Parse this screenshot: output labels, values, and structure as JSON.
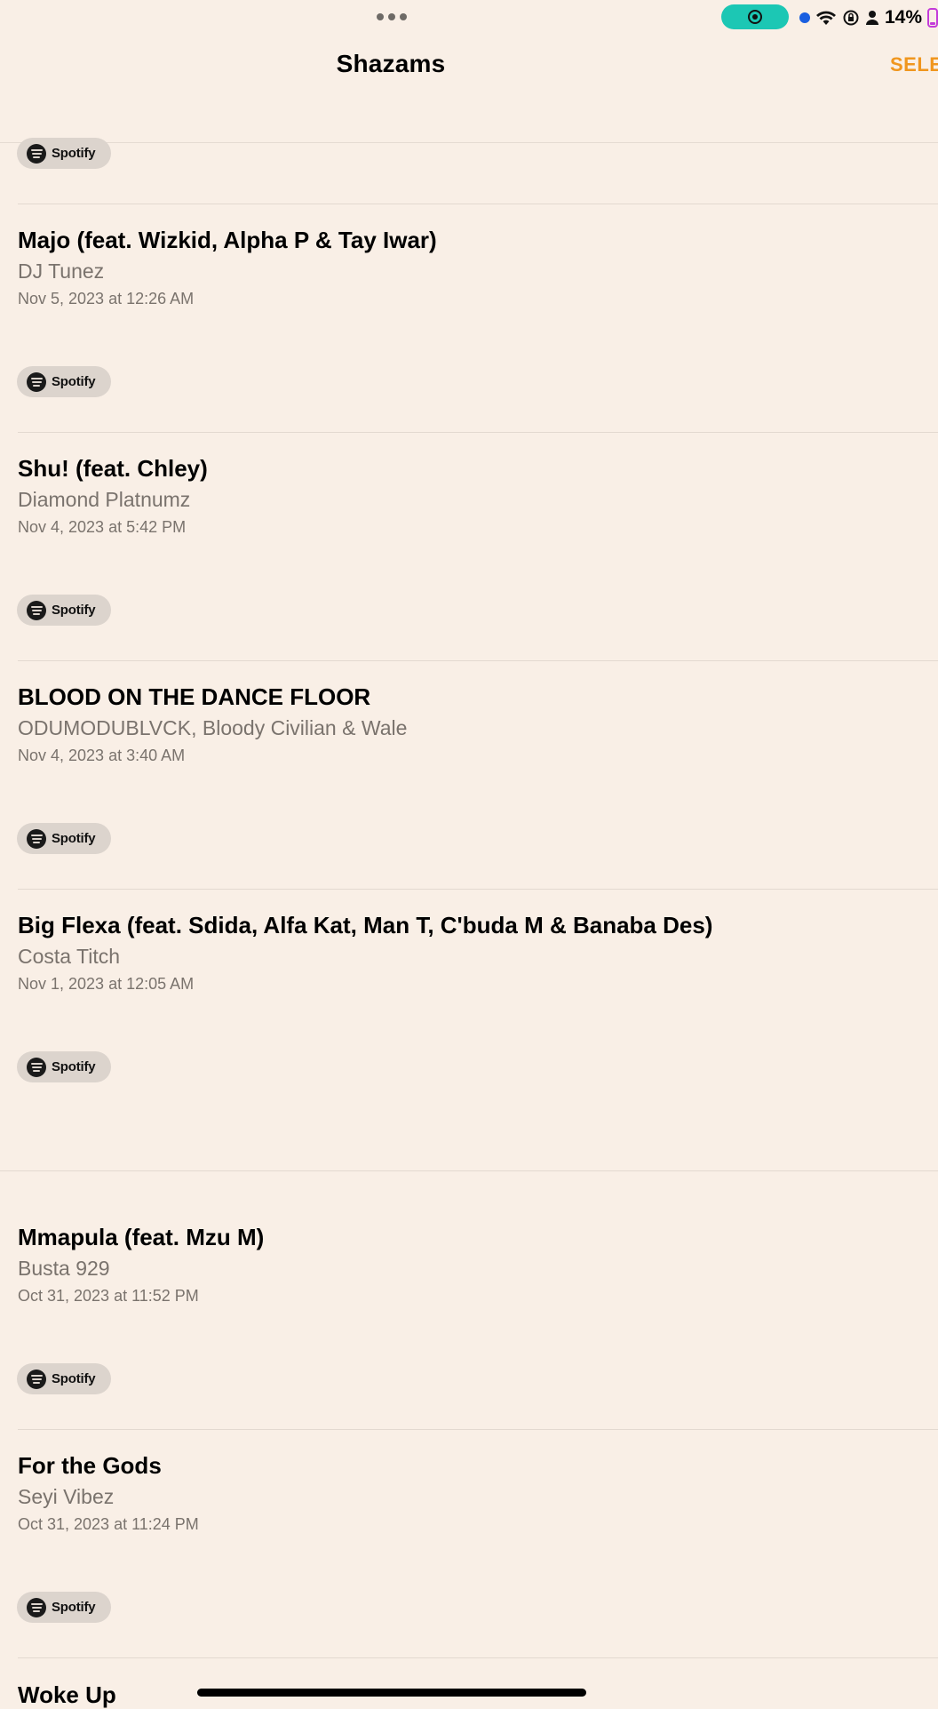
{
  "status_bar": {
    "battery_percent": "14%",
    "accent_record": "#1cc7b4",
    "battery_color": "#c33bd9"
  },
  "nav": {
    "title": "Shazams",
    "select_label": "SELE",
    "accent": "#f0961e"
  },
  "spotify_label": "Spotify",
  "tracks": [
    {
      "title": "Majo (feat. Wizkid, Alpha P & Tay Iwar)",
      "artist": "DJ Tunez",
      "date": "Nov 5, 2023 at 12:26 AM"
    },
    {
      "title": "Shu! (feat. Chley)",
      "artist": "Diamond Platnumz",
      "date": "Nov 4, 2023 at 5:42 PM"
    },
    {
      "title": "BLOOD ON THE DANCE FLOOR",
      "artist": "ODUMODUBLVCK, Bloody Civilian & Wale",
      "date": "Nov 4, 2023 at 3:40 AM"
    },
    {
      "title": "Big Flexa (feat. Sdida, Alfa Kat, Man T, C'buda M & Banaba Des)",
      "artist": "Costa Titch",
      "date": "Nov 1, 2023 at 12:05 AM"
    },
    {
      "title": "Mmapula (feat. Mzu M)",
      "artist": "Busta 929",
      "date": "Oct 31, 2023 at 11:52 PM"
    },
    {
      "title": "For the Gods",
      "artist": "Seyi Vibez",
      "date": "Oct 31, 2023 at 11:24 PM"
    }
  ],
  "partial_track_title": "Woke Up"
}
